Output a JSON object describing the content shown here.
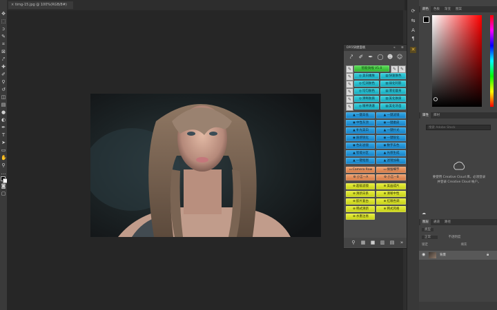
{
  "document_tab": "timg-15.jpg @ 100%(RGB/8#)",
  "plugin": {
    "title": "DR5快捷面板",
    "header_buttons": [
      "«",
      "≡"
    ],
    "top_label": "智能快线 V5.0",
    "cyan_rows": [
      [
        "美白嫩肤",
        "快速肤色"
      ],
      [
        "红润肤色",
        "弱化阿影"
      ],
      [
        "均匀肤色",
        "液化瘦身"
      ],
      [
        "清晰肤质",
        "美化肤质"
      ],
      [
        "眼神清澈",
        "美化牙齿"
      ]
    ],
    "blue_rows": [
      [
        "一键高低",
        "一键滤镜"
      ],
      [
        "中性灰顶",
        "一键磨皮"
      ],
      [
        "补光美白",
        "一键扑光"
      ],
      [
        "质感锐化",
        "一键锐化"
      ],
      [
        "色彩滤镜",
        "数字去色"
      ],
      [
        "智能分区",
        "光感生成"
      ],
      [
        "一键抠图",
        "滤镜加载"
      ]
    ],
    "orange_rows": [
      [
        "Camera Raw",
        "保留细节"
      ],
      [
        "小言—A",
        "小言—B"
      ]
    ],
    "lime_rows": [
      [
        "超级滤镜",
        "美画成片"
      ],
      [
        "清新日系",
        "清晰中性"
      ],
      [
        "胶片复古",
        "红眼色调"
      ],
      [
        "韩式清新",
        "韩式风格"
      ]
    ],
    "last_button": "水墨注易"
  },
  "color_panel": {
    "tabs": [
      "颜色",
      "色板",
      "渐变",
      "图案"
    ],
    "hue_color": "#ff0000"
  },
  "library_panel": {
    "tabs": [
      "属性",
      "库材"
    ],
    "search_placeholder": "搜索 Adobe Stock",
    "cc_message_line1": "要使用 Creative Cloud 库，必须登录",
    "cc_message_line2": "并登录 Creative Cloud 帐户。"
  },
  "layers_panel": {
    "tabs": [
      "图层",
      "通道",
      "路径"
    ],
    "kind_filter": "类型",
    "blend_mode": "正常",
    "opacity_label": "不透明度",
    "lock_label": "锁定",
    "fill_label": "填充",
    "layer_name": "背景"
  }
}
